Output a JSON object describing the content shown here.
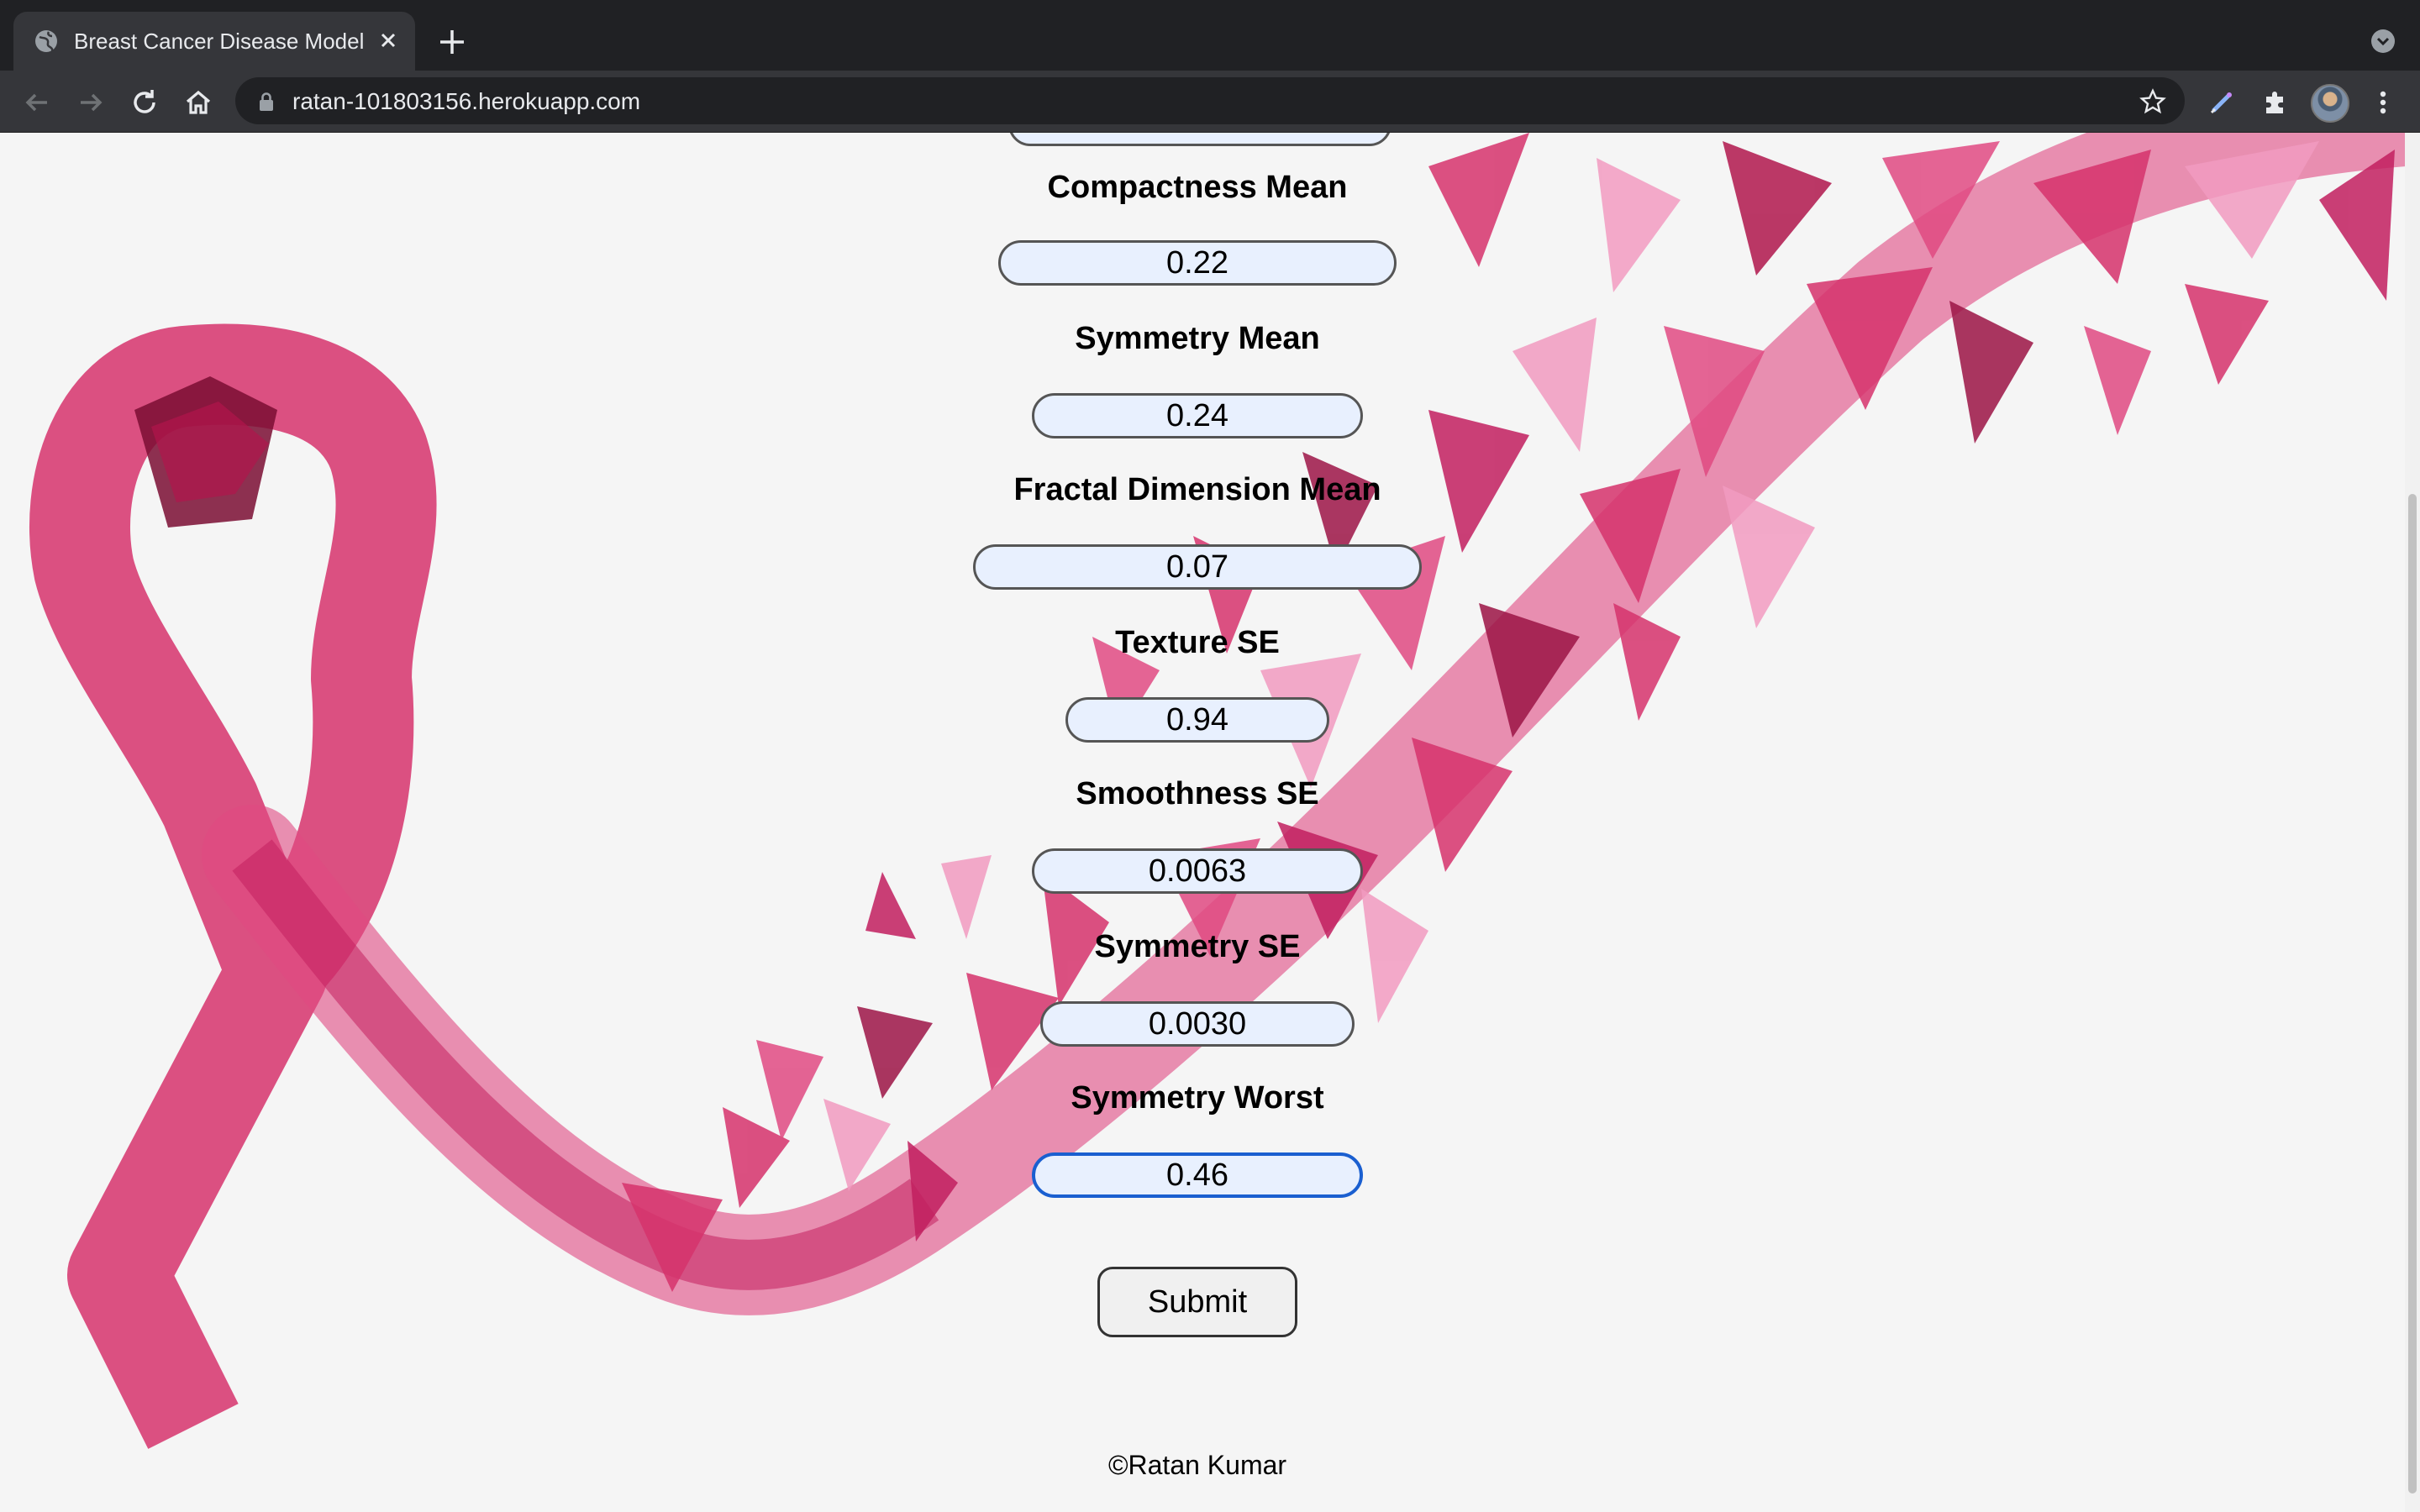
{
  "browser": {
    "tab_title": "Breast Cancer Disease Model",
    "url": "ratan-101803156.herokuapp.com"
  },
  "form": {
    "fields": [
      {
        "label": "Compactness Mean",
        "value": "0.22"
      },
      {
        "label": "Symmetry Mean",
        "value": "0.24"
      },
      {
        "label": "Fractal Dimension Mean",
        "value": "0.07"
      },
      {
        "label": "Texture SE",
        "value": "0.94"
      },
      {
        "label": "Smoothness SE",
        "value": "0.0063"
      },
      {
        "label": "Symmetry SE",
        "value": "0.0030"
      },
      {
        "label": "Symmetry Worst",
        "value": "0.46"
      }
    ],
    "submit_label": "Submit"
  },
  "footer": {
    "text": "©Ratan Kumar"
  },
  "colors": {
    "ribbon_primary": "#d6336c",
    "ribbon_dark": "#9c1446",
    "ribbon_light": "#f29bc1",
    "input_fill": "#e8f0fe",
    "focus_border": "#1a5fd0"
  }
}
